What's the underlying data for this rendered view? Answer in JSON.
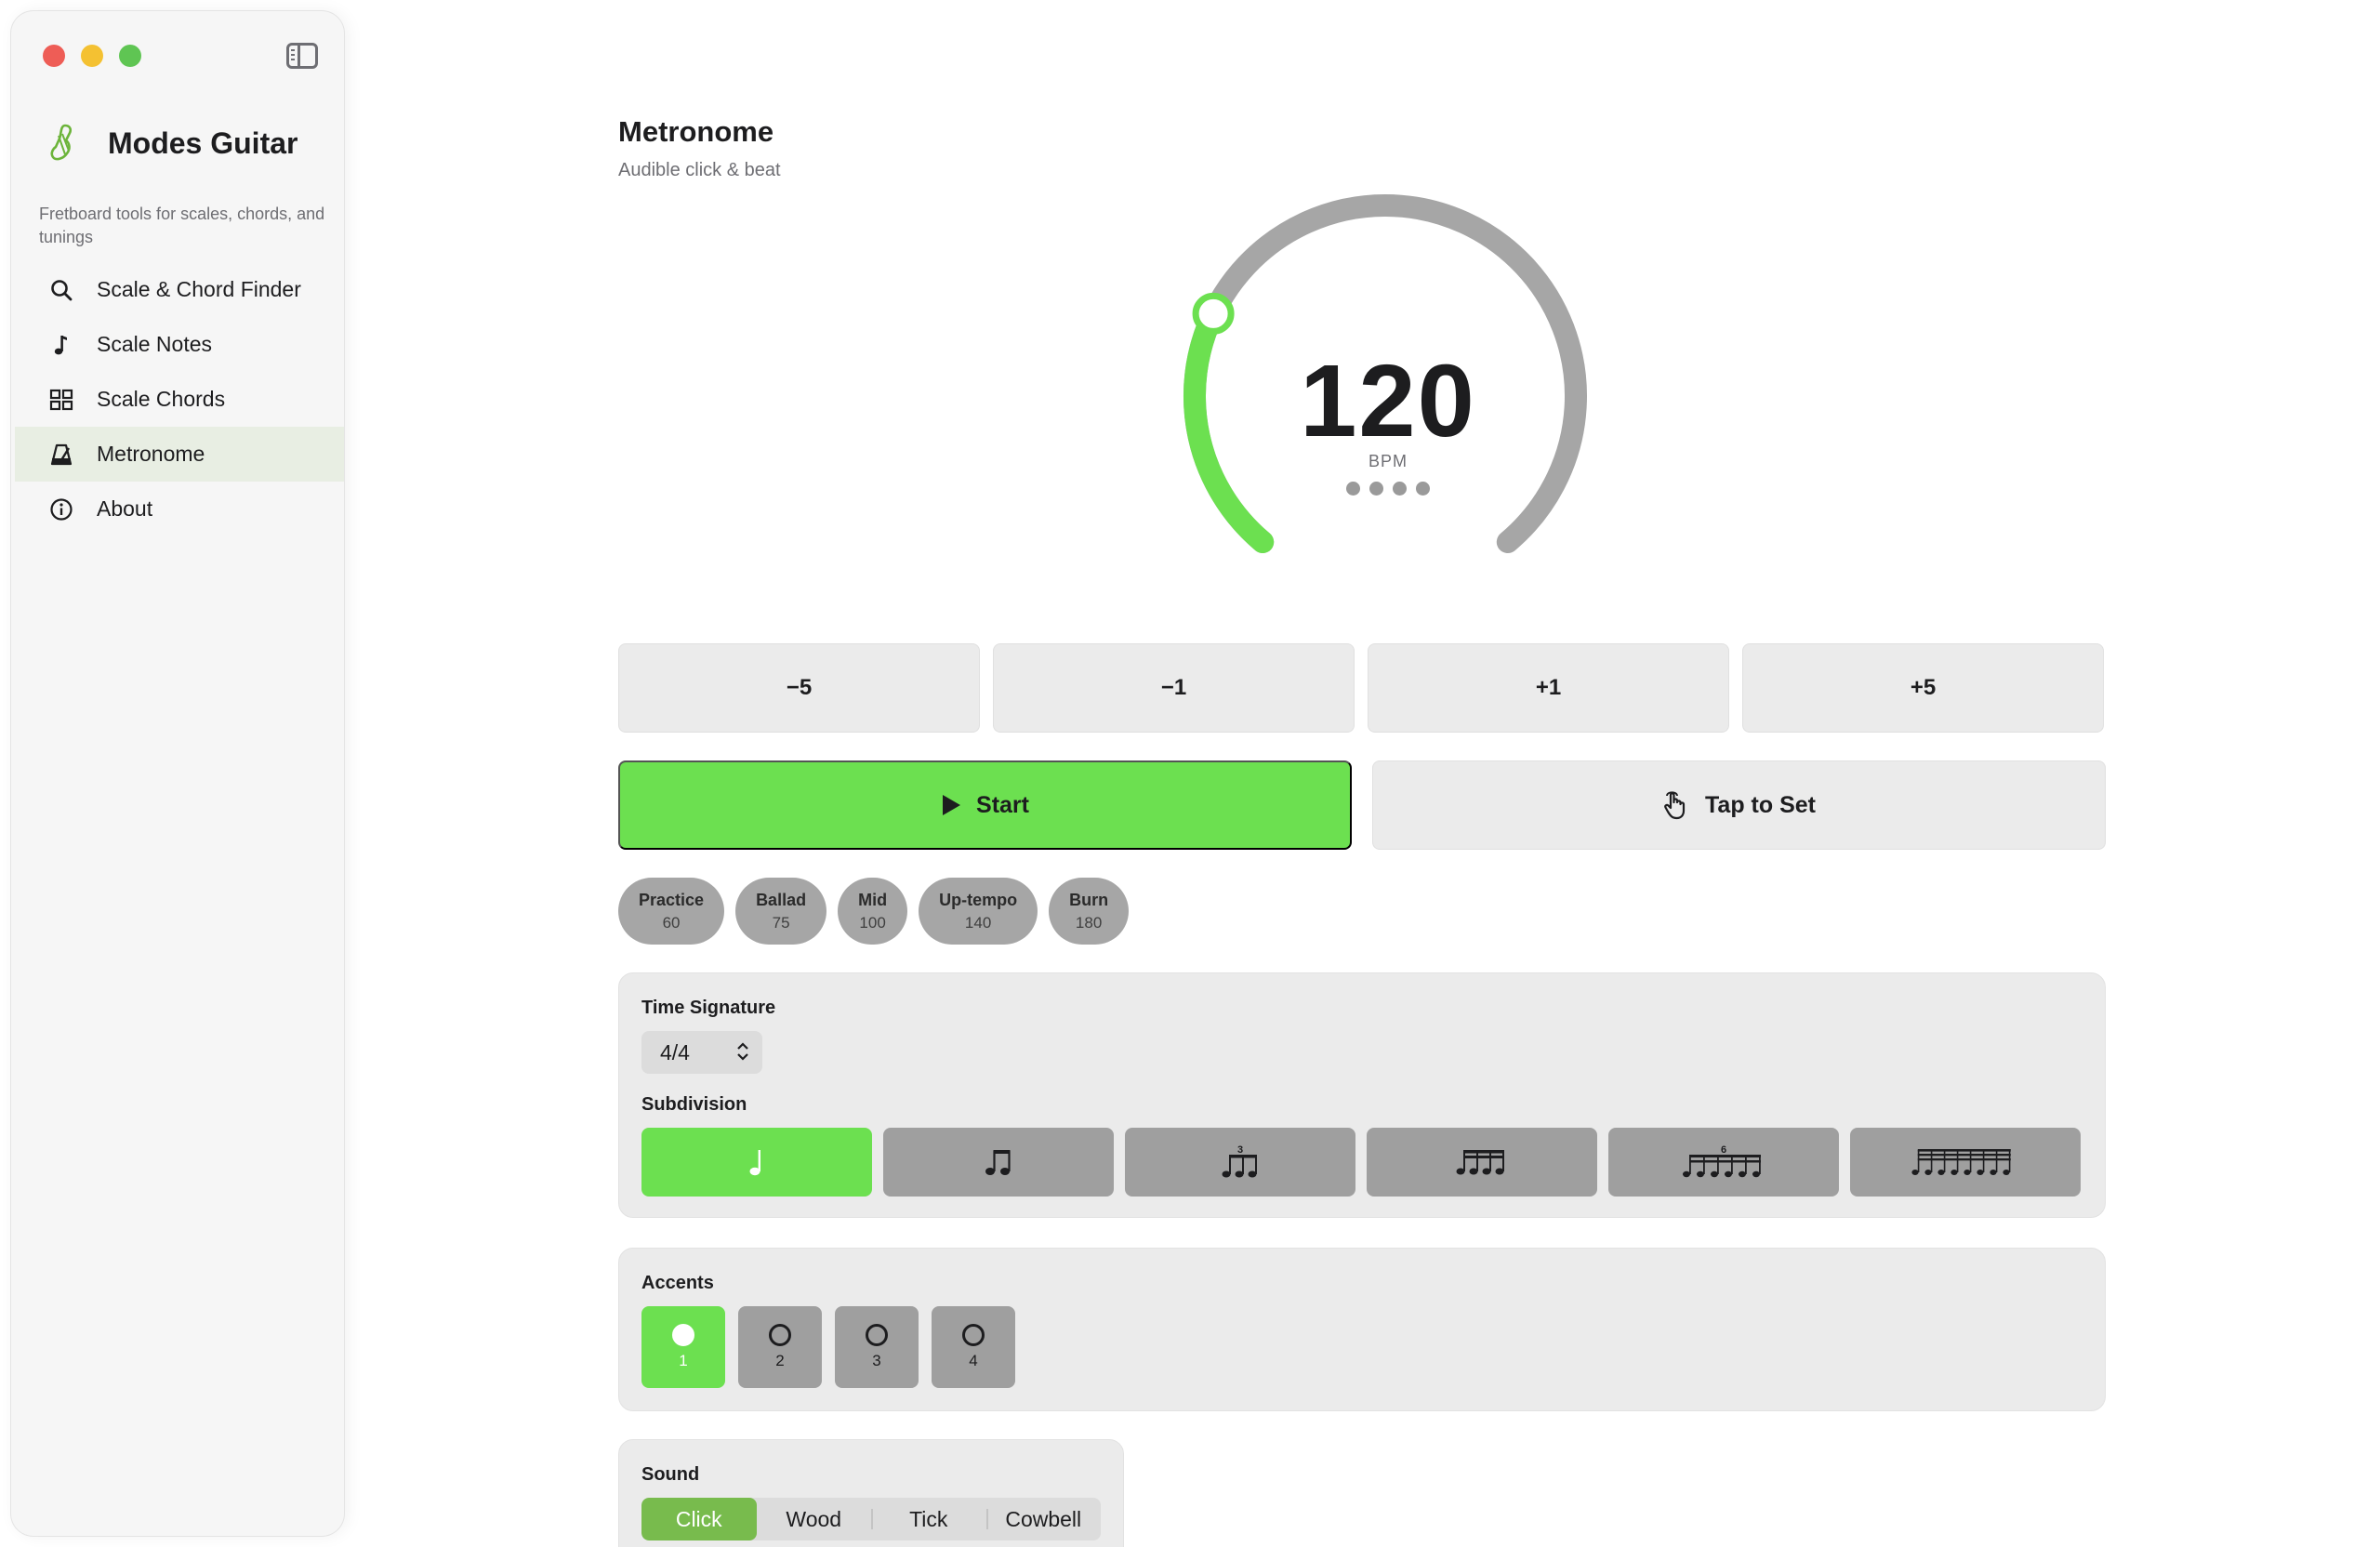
{
  "sidebar": {
    "app_name": "Modes Guitar",
    "tagline": "Fretboard tools for scales, chords, and tunings",
    "items": [
      {
        "label": "Scale & Chord Finder",
        "icon": "magnifier-icon"
      },
      {
        "label": "Scale Notes",
        "icon": "music-note-icon"
      },
      {
        "label": "Scale Chords",
        "icon": "grid-icon"
      },
      {
        "label": "Metronome",
        "icon": "metronome-icon",
        "active": true
      },
      {
        "label": "About",
        "icon": "info-icon"
      }
    ]
  },
  "header": {
    "title": "Metronome",
    "subtitle": "Audible click & beat"
  },
  "dial": {
    "bpm": "120",
    "label": "BPM",
    "fill_fraction": 0.27,
    "beats": 4
  },
  "steps": [
    "−5",
    "−1",
    "+1",
    "+5"
  ],
  "actions": {
    "start": "Start",
    "tap": "Tap to Set"
  },
  "presets": [
    {
      "name": "Practice",
      "bpm": "60"
    },
    {
      "name": "Ballad",
      "bpm": "75"
    },
    {
      "name": "Mid",
      "bpm": "100"
    },
    {
      "name": "Up-tempo",
      "bpm": "140"
    },
    {
      "name": "Burn",
      "bpm": "180"
    }
  ],
  "time_signature": {
    "label": "Time Signature",
    "value": "4/4"
  },
  "subdivision": {
    "label": "Subdivision",
    "options": [
      "quarter-note-icon",
      "eighth-notes-icon",
      "triplet-icon",
      "sixteenth-notes-icon",
      "sextuplet-icon",
      "thirty-second-notes-icon"
    ],
    "triplet_digit": "3",
    "sextuplet_digit": "6",
    "selected_index": 0
  },
  "accents": {
    "label": "Accents",
    "beats": [
      "1",
      "2",
      "3",
      "4"
    ],
    "active_index": 0
  },
  "sound": {
    "label": "Sound",
    "options": [
      "Click",
      "Wood",
      "Tick",
      "Cowbell"
    ],
    "selected_index": 0
  },
  "colors": {
    "accent_green": "#6ce050",
    "segment_green": "#78bb4d",
    "track_gray": "#a6a6a6"
  }
}
